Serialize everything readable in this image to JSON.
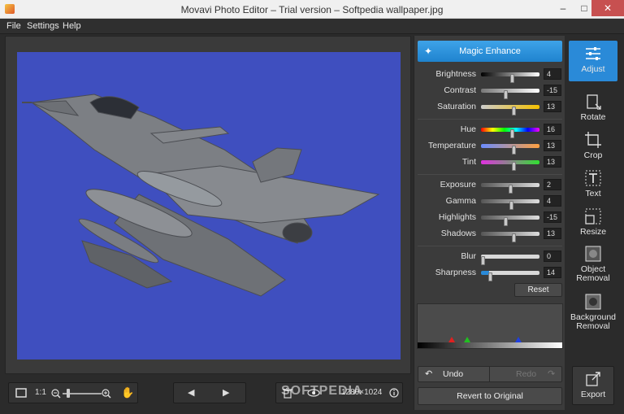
{
  "window": {
    "title": "Movavi Photo Editor – Trial version – Softpedia wallpaper.jpg"
  },
  "menu": {
    "file": "File",
    "settings": "Settings",
    "help": "Help"
  },
  "adjust_panel": {
    "magic_label": "Magic Enhance",
    "sliders": [
      {
        "label": "Brightness",
        "value": "4"
      },
      {
        "label": "Contrast",
        "value": "-15"
      },
      {
        "label": "Saturation",
        "value": "13"
      },
      {
        "label": "Hue",
        "value": "16"
      },
      {
        "label": "Temperature",
        "value": "13"
      },
      {
        "label": "Tint",
        "value": "13"
      },
      {
        "label": "Exposure",
        "value": "2"
      },
      {
        "label": "Gamma",
        "value": "4"
      },
      {
        "label": "Highlights",
        "value": "-15"
      },
      {
        "label": "Shadows",
        "value": "13"
      },
      {
        "label": "Blur",
        "value": "0"
      },
      {
        "label": "Sharpness",
        "value": "14"
      }
    ],
    "reset_label": "Reset",
    "undo_label": "Undo",
    "redo_label": "Redo",
    "revert_label": "Revert to Original"
  },
  "tools": {
    "adjust": "Adjust",
    "rotate": "Rotate",
    "crop": "Crop",
    "text": "Text",
    "resize": "Resize",
    "object_removal": "Object Removal",
    "background_removal": "Background Removal",
    "export": "Export"
  },
  "bottom": {
    "ratio_label": "1:1",
    "dimensions": "1280×1024"
  },
  "watermark": "SOFTPEDIA",
  "colors": {
    "accent": "#2a8ad8",
    "photo_bg": "#3f4fbf"
  }
}
